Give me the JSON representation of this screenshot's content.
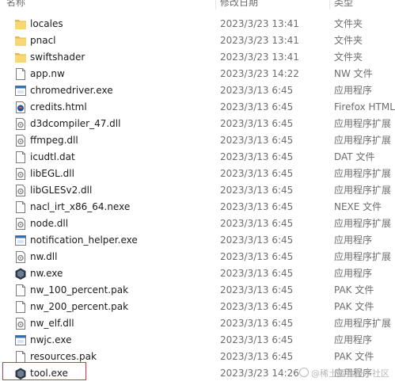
{
  "columns": {
    "name": "名称",
    "date": "修改日期",
    "type": "类型"
  },
  "files": [
    {
      "name": "locales",
      "date": "2023/3/23 13:41",
      "type": "文件夹",
      "icon": "folder"
    },
    {
      "name": "pnacl",
      "date": "2023/3/23 13:41",
      "type": "文件夹",
      "icon": "folder"
    },
    {
      "name": "swiftshader",
      "date": "2023/3/23 13:41",
      "type": "文件夹",
      "icon": "folder"
    },
    {
      "name": "app.nw",
      "date": "2023/3/23 14:22",
      "type": "NW 文件",
      "icon": "file"
    },
    {
      "name": "chromedriver.exe",
      "date": "2023/3/13 6:45",
      "type": "应用程序",
      "icon": "exe"
    },
    {
      "name": "credits.html",
      "date": "2023/3/13 6:45",
      "type": "Firefox HTML Document",
      "icon": "html"
    },
    {
      "name": "d3dcompiler_47.dll",
      "date": "2023/3/13 6:45",
      "type": "应用程序扩展",
      "icon": "dll"
    },
    {
      "name": "ffmpeg.dll",
      "date": "2023/3/13 6:45",
      "type": "应用程序扩展",
      "icon": "dll"
    },
    {
      "name": "icudtl.dat",
      "date": "2023/3/13 6:45",
      "type": "DAT 文件",
      "icon": "file"
    },
    {
      "name": "libEGL.dll",
      "date": "2023/3/13 6:45",
      "type": "应用程序扩展",
      "icon": "dll"
    },
    {
      "name": "libGLESv2.dll",
      "date": "2023/3/13 6:45",
      "type": "应用程序扩展",
      "icon": "dll"
    },
    {
      "name": "nacl_irt_x86_64.nexe",
      "date": "2023/3/13 6:45",
      "type": "NEXE 文件",
      "icon": "file"
    },
    {
      "name": "node.dll",
      "date": "2023/3/13 6:45",
      "type": "应用程序扩展",
      "icon": "dll"
    },
    {
      "name": "notification_helper.exe",
      "date": "2023/3/13 6:45",
      "type": "应用程序",
      "icon": "exe"
    },
    {
      "name": "nw.dll",
      "date": "2023/3/13 6:45",
      "type": "应用程序扩展",
      "icon": "dll"
    },
    {
      "name": "nw.exe",
      "date": "2023/3/13 6:45",
      "type": "应用程序",
      "icon": "nw"
    },
    {
      "name": "nw_100_percent.pak",
      "date": "2023/3/13 6:45",
      "type": "PAK 文件",
      "icon": "file"
    },
    {
      "name": "nw_200_percent.pak",
      "date": "2023/3/13 6:45",
      "type": "PAK 文件",
      "icon": "file"
    },
    {
      "name": "nw_elf.dll",
      "date": "2023/3/13 6:45",
      "type": "应用程序扩展",
      "icon": "dll"
    },
    {
      "name": "nwjc.exe",
      "date": "2023/3/13 6:45",
      "type": "应用程序",
      "icon": "exe"
    },
    {
      "name": "resources.pak",
      "date": "2023/3/13 6:45",
      "type": "PAK 文件",
      "icon": "file"
    },
    {
      "name": "tool.exe",
      "date": "2023/3/23 14:26",
      "type": "应用程序",
      "icon": "nw"
    }
  ],
  "watermark": "@稀土掘金技术社区",
  "colors": {
    "folder": "#f8d775",
    "folder_dark": "#e8b84a",
    "highlight": "#d9333f",
    "exe_blue": "#2e6fb6",
    "nw_dark": "#2b3a4a"
  }
}
